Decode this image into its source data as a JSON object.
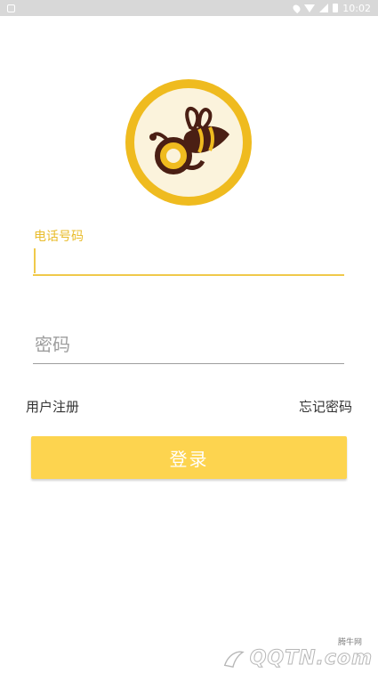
{
  "statusbar": {
    "time": "10:02"
  },
  "logo": {
    "icon": "bee-icon",
    "ring_color": "#efbb1f",
    "face_color": "#fbf3dc",
    "mark_color": "#4a1f14"
  },
  "form": {
    "phone_label": "电话号码",
    "phone_value": "",
    "password_placeholder": "密码"
  },
  "links": {
    "register": "用户注册",
    "forgot": "忘记密码"
  },
  "login_button": "登录",
  "accent_color": "#fdd44f",
  "watermark": {
    "small": "腾牛网",
    "main": "QQTN.com"
  }
}
